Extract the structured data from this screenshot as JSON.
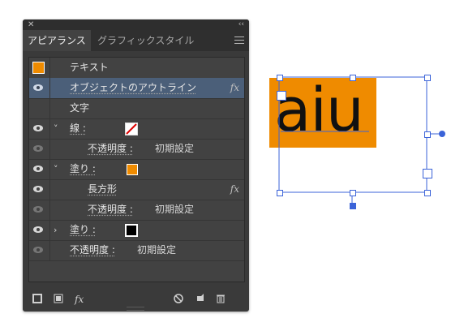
{
  "panel": {
    "tabs": [
      "アピアランス",
      "グラフィックスタイル"
    ],
    "rows": [
      {
        "label": "テキスト"
      },
      {
        "label": "オブジェクトのアウトライン",
        "fx": "fx"
      },
      {
        "label": "文字"
      },
      {
        "label": "線 :",
        "swatch": "stroke-none"
      },
      {
        "label": "不透明度 :",
        "value": "初期設定"
      },
      {
        "label": "塗り :",
        "swatch": "#ef8b00"
      },
      {
        "label": "長方形",
        "fx": "fx"
      },
      {
        "label": "不透明度 :",
        "value": "初期設定"
      },
      {
        "label": "塗り :",
        "swatch": "#000000"
      },
      {
        "label": "不透明度 :",
        "value": "初期設定"
      }
    ],
    "bottom_fx": "fx"
  },
  "canvas": {
    "art_text": "aiu",
    "fill_color": "#ef8b00",
    "selection_color": "#3b63d8"
  }
}
